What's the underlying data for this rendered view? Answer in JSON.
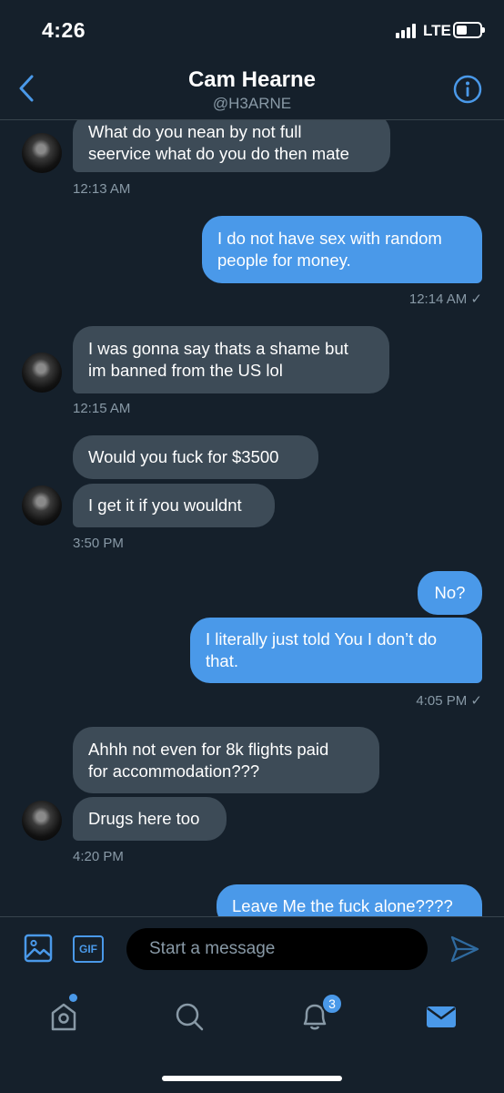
{
  "status_bar": {
    "time": "4:26",
    "network": "LTE"
  },
  "header": {
    "name": "Cam Hearne",
    "handle": "@H3ARNE"
  },
  "messages": [
    {
      "line1": "What do you nean by not full",
      "line2": "seervice what do you do then mate"
    },
    {
      "line1": "I do not have sex with random",
      "line2": "people for money."
    },
    {
      "line1": "I was gonna say thats a shame but",
      "line2": "im banned from the US lol"
    },
    {
      "text": "Would you fuck for $3500"
    },
    {
      "text": "I get it if you wouldnt"
    },
    {
      "text": "No?"
    },
    {
      "line1": "I literally just told You I don’t do",
      "line2": "that."
    },
    {
      "line1": "Ahhh not even for  8k flights paid",
      "line2": "for accommodation???"
    },
    {
      "text": "Drugs here too"
    },
    {
      "text": "Leave Me the fuck alone????"
    }
  ],
  "timestamps": [
    "12:13 AM",
    "12:14 AM ✓",
    "12:15 AM",
    "3:50 PM",
    "4:05 PM ✓",
    "4:20 PM"
  ],
  "composer": {
    "placeholder": "Start a message",
    "gif_label": "GIF"
  },
  "tabbar": {
    "notifications_badge": "3"
  },
  "colors": {
    "background": "#15202b",
    "incoming_bubble": "#3d4b57",
    "outgoing_bubble": "#4a99e9",
    "muted_text": "#8899a6",
    "accent": "#4a99e9"
  }
}
